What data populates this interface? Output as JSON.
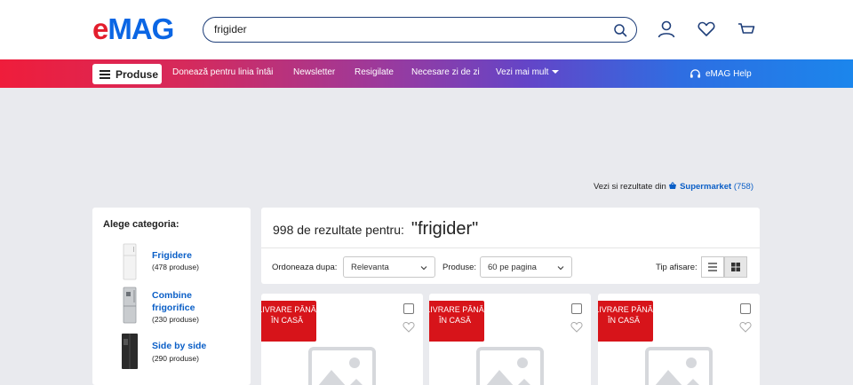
{
  "header": {
    "logo": {
      "e": "e",
      "mag": "MAG"
    },
    "search": {
      "value": "frigider"
    },
    "icons": [
      "search-icon",
      "user-icon",
      "heart-icon",
      "cart-icon"
    ]
  },
  "nav": {
    "products_label": "Produse",
    "links": [
      "Donează pentru linia întâi",
      "Newsletter",
      "Resigilate",
      "Necesare zi de zi",
      "Vezi mai mult"
    ],
    "help_label": "eMAG Help"
  },
  "supermarket": {
    "prefix": "Vezi si rezultate din",
    "name": "Supermarket",
    "count": "(758)"
  },
  "sidebar": {
    "title": "Alege categoria:",
    "categories": [
      {
        "name": "Frigidere",
        "count": "(478 produse)"
      },
      {
        "name": "Combine frigorifice",
        "count": "(230 produse)"
      },
      {
        "name": "Side by side",
        "count": "(290 produse)"
      }
    ]
  },
  "results": {
    "count_text": "998 de rezultate pentru:",
    "query_text": "\"frigider\"",
    "sort_label": "Ordoneaza dupa:",
    "sort_value": "Relevanta",
    "per_page_label": "Produse:",
    "per_page_value": "60 pe pagina",
    "view_label": "Tip afisare:"
  },
  "cards": [
    {
      "badge": "LIVRARE PÂNĂ ÎN CASĂ"
    },
    {
      "badge": "LIVRARE PÂNĂ ÎN CASĂ"
    },
    {
      "badge": "LIVRARE PÂNĂ ÎN CASĂ"
    }
  ],
  "colors": {
    "brand_red": "#e31e2d",
    "brand_blue": "#0b66e4",
    "link_blue": "#0b5fc7",
    "badge_red": "#d7141a"
  }
}
